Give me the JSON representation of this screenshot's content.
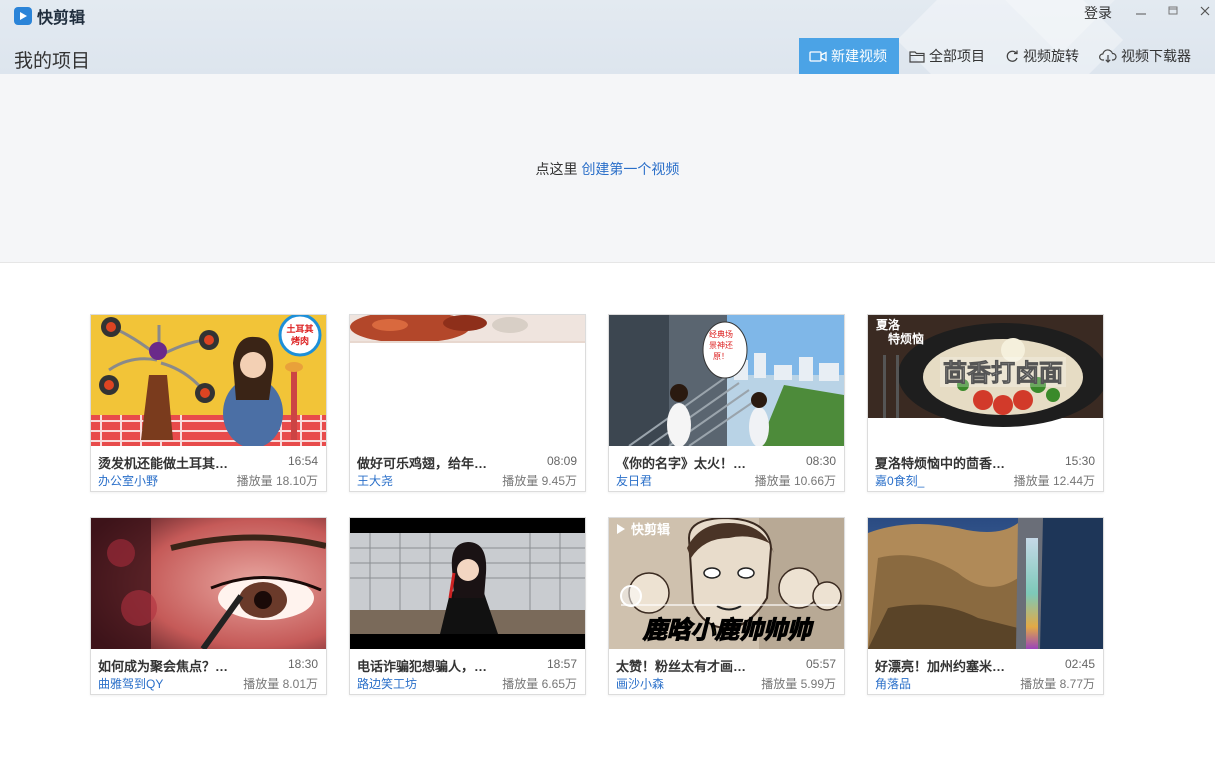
{
  "app": {
    "name": "快剪辑",
    "logo_icon": "play-icon"
  },
  "window": {
    "login_label": "登录"
  },
  "page": {
    "title": "我的项目"
  },
  "toolbar": {
    "new_video": "新建视频",
    "all_projects": "全部项目",
    "rotate_video": "视频旋转",
    "downloader": "视频下载器"
  },
  "hero": {
    "prefix": "点这里 ",
    "link": "创建第一个视频"
  },
  "colors": {
    "accent": "#4ba3e6",
    "link": "#2a6fc9",
    "topbar": "#dde5ee"
  },
  "videos": [
    {
      "title": "烫发机还能做土耳其…",
      "duration": "16:54",
      "author": "办公室小野",
      "plays": "播放量 18.10万",
      "thumb_text": "土耳其烤肉"
    },
    {
      "title": "做好可乐鸡翅，给年…",
      "duration": "08:09",
      "author": "王大尧",
      "plays": "播放量 9.45万"
    },
    {
      "title": "《你的名字》太火！…",
      "duration": "08:30",
      "author": "友日君",
      "plays": "播放量 10.66万",
      "thumb_text": "经典场景神还原！"
    },
    {
      "title": "夏洛特烦恼中的茴香…",
      "duration": "15:30",
      "author": "嘉0食刻_",
      "plays": "播放量 12.44万",
      "thumb_text": "茴香打卤面",
      "thumb_tag": "夏洛特烦恼"
    },
    {
      "title": "如何成为聚会焦点？…",
      "duration": "18:30",
      "author": "曲雅驾到QY",
      "plays": "播放量 8.01万"
    },
    {
      "title": "电话诈骗犯想骗人，…",
      "duration": "18:57",
      "author": "路边笑工坊",
      "plays": "播放量 6.65万"
    },
    {
      "title": "太赞！粉丝太有才画…",
      "duration": "05:57",
      "author": "画沙小森",
      "plays": "播放量 5.99万",
      "thumb_text": "鹿晗小鹿帅帅帅",
      "thumb_logo": "快剪辑"
    },
    {
      "title": "好漂亮！加州约塞米…",
      "duration": "02:45",
      "author": "角落品",
      "plays": "播放量 8.77万"
    }
  ]
}
